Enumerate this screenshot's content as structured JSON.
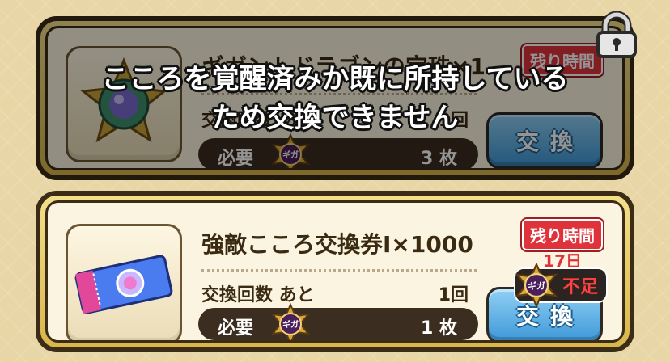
{
  "items": [
    {
      "name": "ギガントドラゴンの宝珠×1",
      "count_label": "交換回数 あと",
      "count_value": "1回",
      "need_label": "必要",
      "need_amount": "3 枚",
      "timer_label": "残り時間",
      "exchange_label": "交換",
      "locked": true,
      "icon": "dragon-orb-icon"
    },
    {
      "name": "強敵こころ交換券Ⅰ×1000",
      "count_label": "交換回数 あと",
      "count_value": "1回",
      "need_label": "必要",
      "need_amount": "1 枚",
      "timer_label": "残り時間",
      "timer_days": "17日",
      "exchange_label": "交換",
      "insufficient_label": "不足",
      "icon": "ticket-icon"
    }
  ],
  "lock_message": {
    "line1": "こころを覚醒済みか既に所持している",
    "line2": "ため交換できません"
  },
  "medal_text": "ギガ",
  "colors": {
    "accent_red": "#e0323a",
    "button_blue": "#3f98d8",
    "frame_gold": "#d9b54a"
  }
}
